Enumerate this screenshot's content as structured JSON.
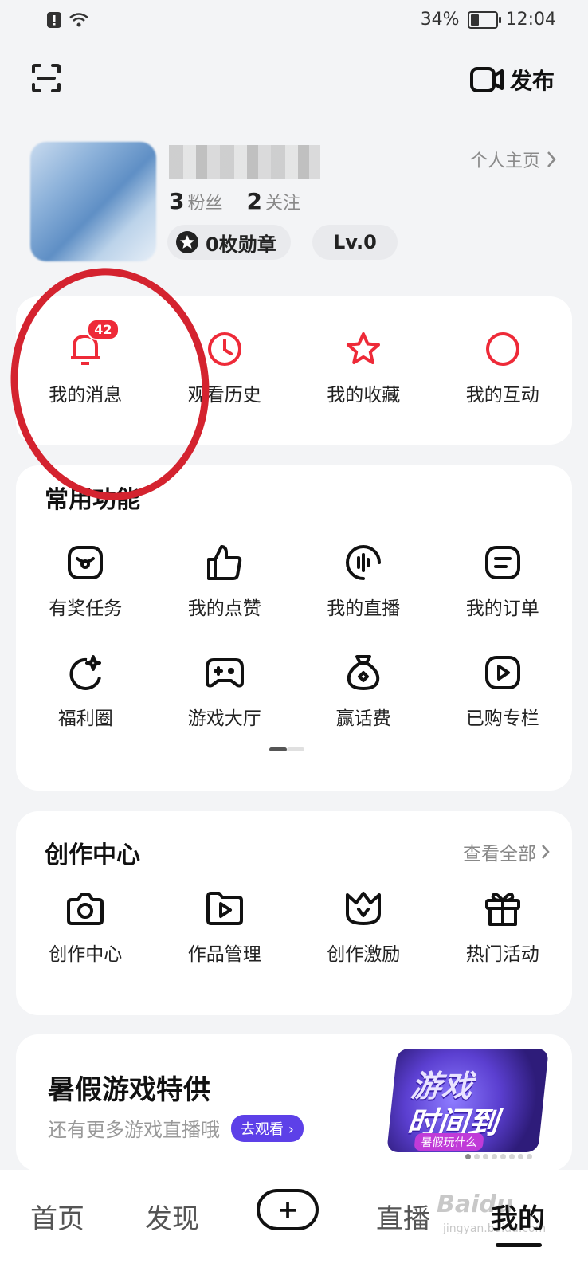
{
  "status_bar": {
    "battery": "34%",
    "battery_level": 0.34,
    "time": "12:04"
  },
  "header": {
    "publish_label": "发布"
  },
  "profile": {
    "homepage_link": "个人主页",
    "fans_count": "3",
    "fans_label": "粉丝",
    "follow_count": "2",
    "follow_label": "关注",
    "medal_label": "0枚勋章",
    "level_label": "Lv.0"
  },
  "quick_actions": [
    {
      "label": "我的消息",
      "icon": "bell-icon",
      "badge": "42"
    },
    {
      "label": "观看历史",
      "icon": "clock-icon"
    },
    {
      "label": "我的收藏",
      "icon": "star-icon"
    },
    {
      "label": "我的互动",
      "icon": "circle-icon"
    }
  ],
  "common_functions": {
    "title": "常用功能",
    "items": [
      {
        "label": "有奖任务",
        "icon": "task-icon"
      },
      {
        "label": "我的点赞",
        "icon": "thumbs-up-icon"
      },
      {
        "label": "我的直播",
        "icon": "live-icon"
      },
      {
        "label": "我的订单",
        "icon": "order-icon"
      },
      {
        "label": "福利圈",
        "icon": "moon-sparkle-icon"
      },
      {
        "label": "游戏大厅",
        "icon": "gamepad-icon"
      },
      {
        "label": "赢话费",
        "icon": "money-bag-icon"
      },
      {
        "label": "已购专栏",
        "icon": "play-square-icon"
      }
    ]
  },
  "creator_center": {
    "title": "创作中心",
    "see_all": "查看全部",
    "items": [
      {
        "label": "创作中心",
        "icon": "camera-icon"
      },
      {
        "label": "作品管理",
        "icon": "folder-play-icon"
      },
      {
        "label": "创作激励",
        "icon": "crown-icon"
      },
      {
        "label": "热门活动",
        "icon": "gift-icon"
      }
    ]
  },
  "promo": {
    "title": "暑假游戏特供",
    "subtitle": "还有更多游戏直播哦",
    "button": "去观看",
    "art_line1": "游戏",
    "art_line2": "时间到",
    "art_tag": "暑假玩什么"
  },
  "bottom_nav": {
    "items": [
      "首页",
      "发现",
      "直播",
      "我的"
    ],
    "active": "我的"
  },
  "watermark": {
    "text": "Baidu",
    "sub": "jingyan.baidu.com"
  },
  "colors": {
    "accent_red": "#ee2a38",
    "annotation_red": "#d4232f",
    "promo_purple": "#5d40e8"
  }
}
